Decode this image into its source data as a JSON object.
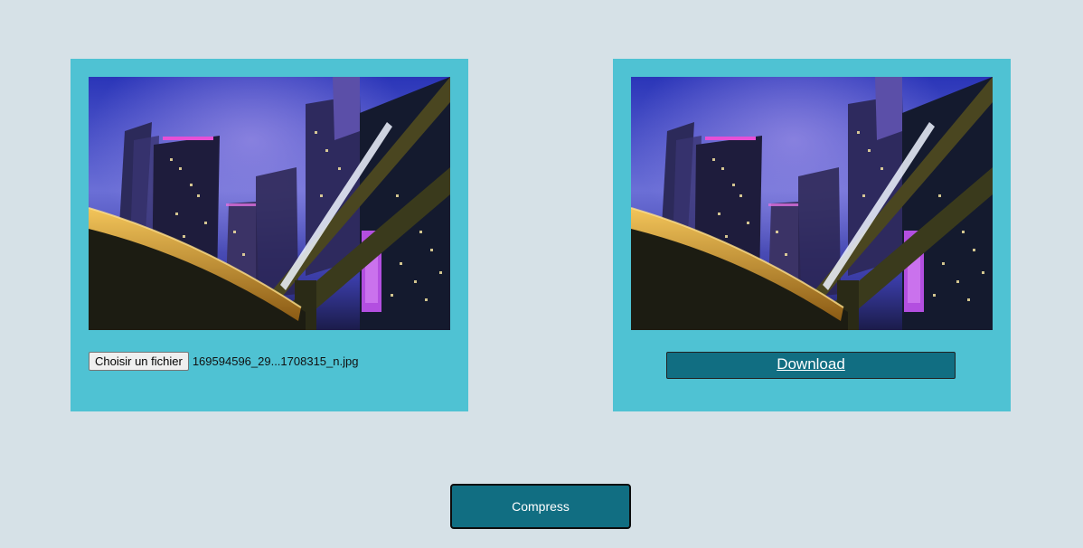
{
  "original_panel": {
    "image_alt": "city night skyline",
    "file_button_label": "Choisir un fichier",
    "file_name": "169594596_29...1708315_n.jpg"
  },
  "compressed_panel": {
    "image_alt": "city night skyline compressed",
    "download_label": "Download"
  },
  "compress_button_label": "Compress",
  "colors": {
    "page_background": "#d6e1e7",
    "panel_background": "#4fc2d3",
    "button_background": "#116e82"
  }
}
